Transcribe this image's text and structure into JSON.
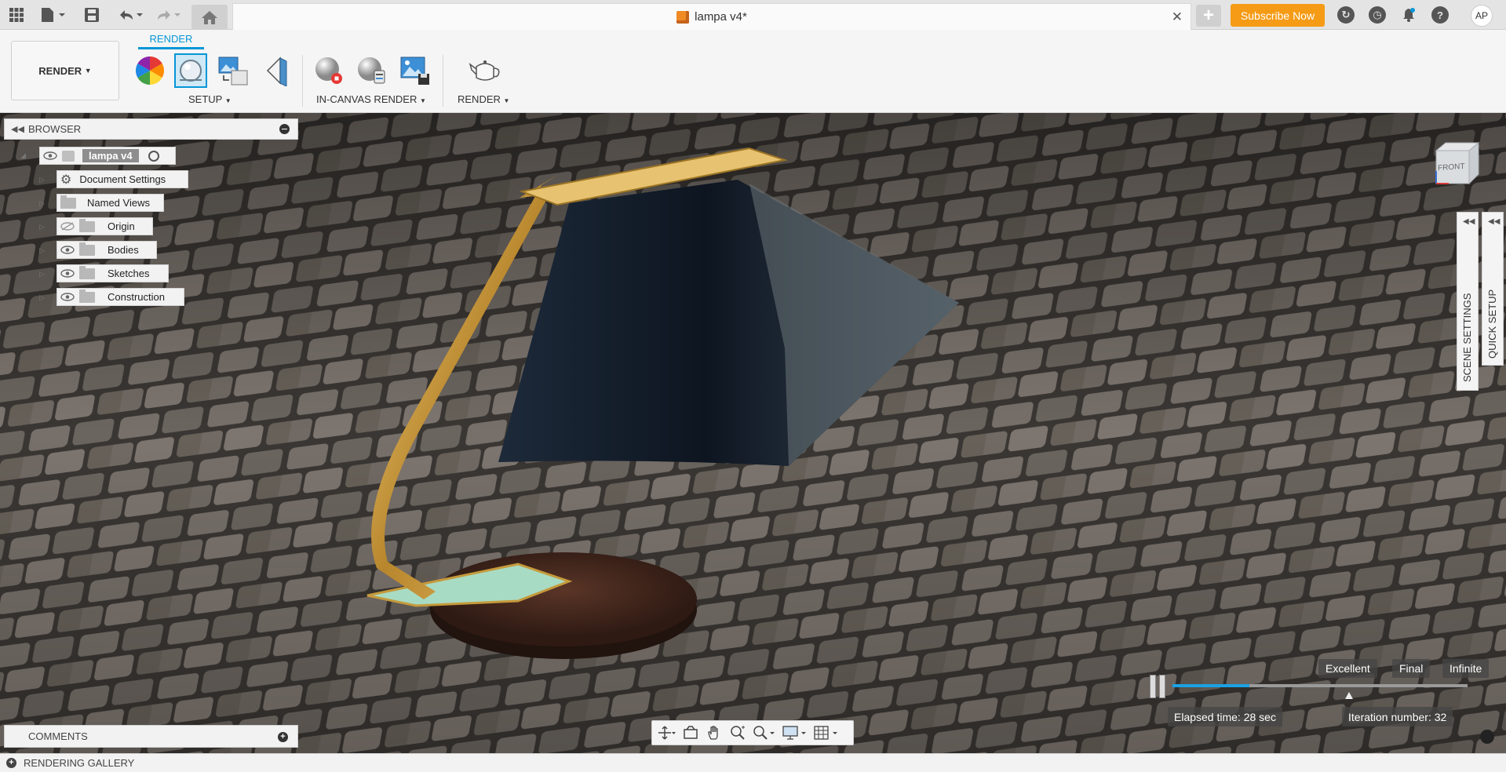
{
  "window": {
    "document_title": "lampa v4*",
    "subscribe_label": "Subscribe Now",
    "user_initials": "AP"
  },
  "ribbon": {
    "workspace_label": "RENDER",
    "active_tab": "RENDER",
    "groups": {
      "setup": "SETUP",
      "in_canvas": "IN-CANVAS RENDER",
      "render": "RENDER"
    }
  },
  "browser": {
    "title": "BROWSER",
    "root": "lampa v4",
    "items": [
      {
        "label": "Document Settings",
        "icon": "gear-icon"
      },
      {
        "label": "Named Views",
        "icon": "folder-icon"
      },
      {
        "label": "Origin",
        "icon": "folder-icon",
        "visible": false
      },
      {
        "label": "Bodies",
        "icon": "folder-icon",
        "visible": true
      },
      {
        "label": "Sketches",
        "icon": "folder-icon",
        "visible": true
      },
      {
        "label": "Construction",
        "icon": "folder-icon",
        "visible": true
      }
    ]
  },
  "side_panels": {
    "scene_settings": "SCENE SETTINGS",
    "quick_setup": "QUICK SETUP"
  },
  "viewcube": {
    "face": "FRONT"
  },
  "render_progress": {
    "quality_levels": [
      "Excellent",
      "Final",
      "Infinite"
    ],
    "progress_fraction": 0.26,
    "elapsed_time": "Elapsed time: 28 sec",
    "iteration": "Iteration number: 32"
  },
  "bottom": {
    "comments": "COMMENTS",
    "rendering_gallery": "RENDERING GALLERY"
  },
  "colors": {
    "accent": "#0696d7",
    "subscribe": "#f59b16",
    "progress": "#1ba1e2"
  }
}
